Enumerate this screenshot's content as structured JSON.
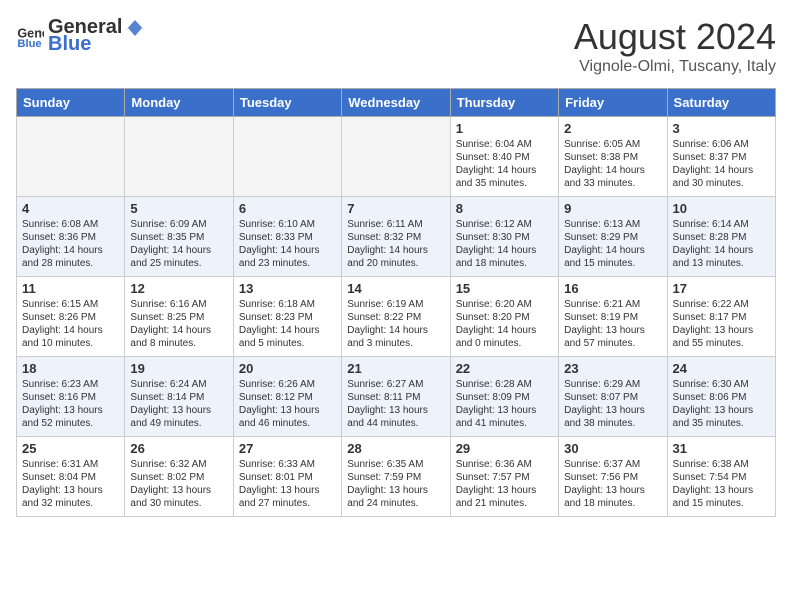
{
  "header": {
    "logo_general": "General",
    "logo_blue": "Blue",
    "month_year": "August 2024",
    "location": "Vignole-Olmi, Tuscany, Italy"
  },
  "weekdays": [
    "Sunday",
    "Monday",
    "Tuesday",
    "Wednesday",
    "Thursday",
    "Friday",
    "Saturday"
  ],
  "weeks": [
    [
      {
        "day": "",
        "content": ""
      },
      {
        "day": "",
        "content": ""
      },
      {
        "day": "",
        "content": ""
      },
      {
        "day": "",
        "content": ""
      },
      {
        "day": "1",
        "content": "Sunrise: 6:04 AM\nSunset: 8:40 PM\nDaylight: 14 hours and 35 minutes."
      },
      {
        "day": "2",
        "content": "Sunrise: 6:05 AM\nSunset: 8:38 PM\nDaylight: 14 hours and 33 minutes."
      },
      {
        "day": "3",
        "content": "Sunrise: 6:06 AM\nSunset: 8:37 PM\nDaylight: 14 hours and 30 minutes."
      }
    ],
    [
      {
        "day": "4",
        "content": "Sunrise: 6:08 AM\nSunset: 8:36 PM\nDaylight: 14 hours and 28 minutes."
      },
      {
        "day": "5",
        "content": "Sunrise: 6:09 AM\nSunset: 8:35 PM\nDaylight: 14 hours and 25 minutes."
      },
      {
        "day": "6",
        "content": "Sunrise: 6:10 AM\nSunset: 8:33 PM\nDaylight: 14 hours and 23 minutes."
      },
      {
        "day": "7",
        "content": "Sunrise: 6:11 AM\nSunset: 8:32 PM\nDaylight: 14 hours and 20 minutes."
      },
      {
        "day": "8",
        "content": "Sunrise: 6:12 AM\nSunset: 8:30 PM\nDaylight: 14 hours and 18 minutes."
      },
      {
        "day": "9",
        "content": "Sunrise: 6:13 AM\nSunset: 8:29 PM\nDaylight: 14 hours and 15 minutes."
      },
      {
        "day": "10",
        "content": "Sunrise: 6:14 AM\nSunset: 8:28 PM\nDaylight: 14 hours and 13 minutes."
      }
    ],
    [
      {
        "day": "11",
        "content": "Sunrise: 6:15 AM\nSunset: 8:26 PM\nDaylight: 14 hours and 10 minutes."
      },
      {
        "day": "12",
        "content": "Sunrise: 6:16 AM\nSunset: 8:25 PM\nDaylight: 14 hours and 8 minutes."
      },
      {
        "day": "13",
        "content": "Sunrise: 6:18 AM\nSunset: 8:23 PM\nDaylight: 14 hours and 5 minutes."
      },
      {
        "day": "14",
        "content": "Sunrise: 6:19 AM\nSunset: 8:22 PM\nDaylight: 14 hours and 3 minutes."
      },
      {
        "day": "15",
        "content": "Sunrise: 6:20 AM\nSunset: 8:20 PM\nDaylight: 14 hours and 0 minutes."
      },
      {
        "day": "16",
        "content": "Sunrise: 6:21 AM\nSunset: 8:19 PM\nDaylight: 13 hours and 57 minutes."
      },
      {
        "day": "17",
        "content": "Sunrise: 6:22 AM\nSunset: 8:17 PM\nDaylight: 13 hours and 55 minutes."
      }
    ],
    [
      {
        "day": "18",
        "content": "Sunrise: 6:23 AM\nSunset: 8:16 PM\nDaylight: 13 hours and 52 minutes."
      },
      {
        "day": "19",
        "content": "Sunrise: 6:24 AM\nSunset: 8:14 PM\nDaylight: 13 hours and 49 minutes."
      },
      {
        "day": "20",
        "content": "Sunrise: 6:26 AM\nSunset: 8:12 PM\nDaylight: 13 hours and 46 minutes."
      },
      {
        "day": "21",
        "content": "Sunrise: 6:27 AM\nSunset: 8:11 PM\nDaylight: 13 hours and 44 minutes."
      },
      {
        "day": "22",
        "content": "Sunrise: 6:28 AM\nSunset: 8:09 PM\nDaylight: 13 hours and 41 minutes."
      },
      {
        "day": "23",
        "content": "Sunrise: 6:29 AM\nSunset: 8:07 PM\nDaylight: 13 hours and 38 minutes."
      },
      {
        "day": "24",
        "content": "Sunrise: 6:30 AM\nSunset: 8:06 PM\nDaylight: 13 hours and 35 minutes."
      }
    ],
    [
      {
        "day": "25",
        "content": "Sunrise: 6:31 AM\nSunset: 8:04 PM\nDaylight: 13 hours and 32 minutes."
      },
      {
        "day": "26",
        "content": "Sunrise: 6:32 AM\nSunset: 8:02 PM\nDaylight: 13 hours and 30 minutes."
      },
      {
        "day": "27",
        "content": "Sunrise: 6:33 AM\nSunset: 8:01 PM\nDaylight: 13 hours and 27 minutes."
      },
      {
        "day": "28",
        "content": "Sunrise: 6:35 AM\nSunset: 7:59 PM\nDaylight: 13 hours and 24 minutes."
      },
      {
        "day": "29",
        "content": "Sunrise: 6:36 AM\nSunset: 7:57 PM\nDaylight: 13 hours and 21 minutes."
      },
      {
        "day": "30",
        "content": "Sunrise: 6:37 AM\nSunset: 7:56 PM\nDaylight: 13 hours and 18 minutes."
      },
      {
        "day": "31",
        "content": "Sunrise: 6:38 AM\nSunset: 7:54 PM\nDaylight: 13 hours and 15 minutes."
      }
    ]
  ]
}
